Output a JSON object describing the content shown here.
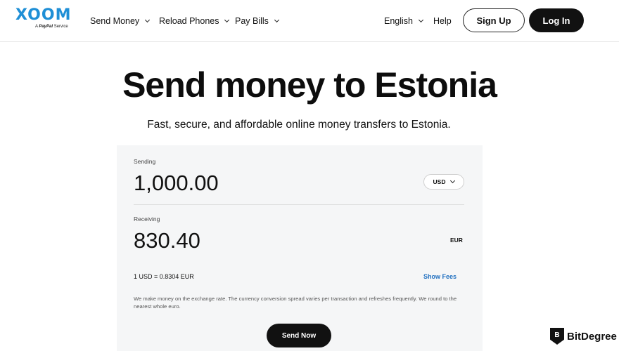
{
  "header": {
    "logo": {
      "word": "XOOM",
      "sub_prefix": "A",
      "sub_brand": "PayPal",
      "sub_suffix": "Service"
    },
    "nav": [
      {
        "label": "Send Money"
      },
      {
        "label": "Reload Phones"
      },
      {
        "label": "Pay Bills"
      }
    ],
    "language": "English",
    "help": "Help",
    "signup": "Sign Up",
    "login": "Log In"
  },
  "hero": {
    "title": "Send money to Estonia",
    "subtitle": "Fast, secure, and affordable online money transfers to Estonia."
  },
  "calculator": {
    "sending_label": "Sending",
    "sending_amount": "1,000.00",
    "sending_currency": "USD",
    "receiving_label": "Receiving",
    "receiving_amount": "830.40",
    "receiving_currency": "EUR",
    "rate": "1 USD = 0.8304 EUR",
    "show_fees": "Show Fees",
    "disclaimer": "We make money on the exchange rate. The currency conversion spread varies per transaction and refreshes frequently. We round to the nearest whole euro.",
    "send_now": "Send Now"
  },
  "watermark": {
    "glyph": "B",
    "text": "BitDegree"
  },
  "colors": {
    "brand": "#1f8fd6",
    "link": "#1f6fc0",
    "dark": "#111111",
    "card_bg": "#f5f6f7"
  }
}
